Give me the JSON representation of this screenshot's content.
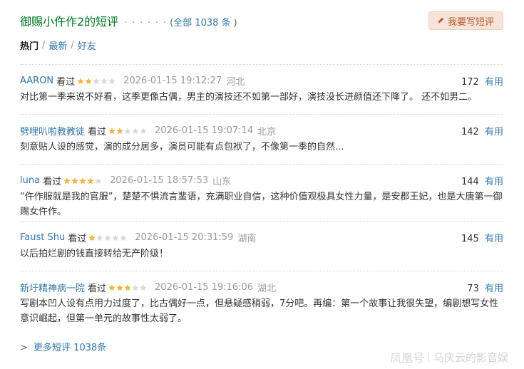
{
  "header": {
    "title": "御赐小仵作2的短评",
    "dots": "· · · · · ·",
    "count_prefix": "( ",
    "count_link": "全部 1038 条",
    "count_suffix": " )",
    "write_button": "我要写短评",
    "write_icon": "pencil-icon"
  },
  "tabs": {
    "hot": "热门",
    "sep1": "/",
    "latest": "最新",
    "sep2": "/",
    "friends": "好友"
  },
  "comments": [
    {
      "user": "AARON",
      "status": "看过",
      "rating": 2,
      "time": "2026-01-15 19:12:27",
      "location": "河北",
      "votes": "172",
      "vote_label": "有用",
      "text": "对比第一季来说不好看，这季更像古偶，男主的演技还不如第一部好，演技没长进颜值还下降了。 还不如男二。"
    },
    {
      "user": "劈哩叭啦教教徒",
      "status": "看过",
      "rating": 2,
      "time": "2026-01-15 19:07:14",
      "location": "北京",
      "votes": "142",
      "vote_label": "有用",
      "text": "刻意贴人设的感觉，演的成分居多，演员可能有点包袱了，不像第一季的自然..."
    },
    {
      "user": "luna",
      "status": "看过",
      "rating": 4,
      "time": "2026-01-15 18:57:53",
      "location": "山东",
      "votes": "144",
      "vote_label": "有用",
      "text": "“仵作服就是我的官服”，楚楚不惧流言蜚语，充满职业自信，这种价值观极具女性力量，是安郡王妃，也是大唐第一御赐女仵作。"
    },
    {
      "user": "Faust Shu",
      "status": "看过",
      "rating": 1,
      "time": "2026-01-15 20:31:59",
      "location": "湖南",
      "votes": "145",
      "vote_label": "有用",
      "text": "以后拍烂剧的钱直接转给无产阶级！"
    },
    {
      "user": "新圩精神病一院",
      "status": "看过",
      "rating": 3,
      "time": "2026-01-15 19:16:06",
      "location": "湖北",
      "votes": "73",
      "vote_label": "有用",
      "text": "写剧本凹人设有点用力过度了，比古偶好一点，但悬疑感稍弱，7分吧。再编：第一个故事让我很失望，编剧想写女性意识崛起，但第一单元的故事性太弱了。"
    }
  ],
  "more": {
    "arrow": ">",
    "label": "更多短评 1038条"
  },
  "watermark": {
    "logo": "凤凰号",
    "name": "马庆云的影音娱"
  },
  "colors": {
    "accent_green": "#007722",
    "link_blue": "#3377aa",
    "star_filled": "#f3b33d",
    "star_empty": "#d9d9d9",
    "button_bg": "#f7e3d7",
    "button_text": "#b35a2d"
  }
}
